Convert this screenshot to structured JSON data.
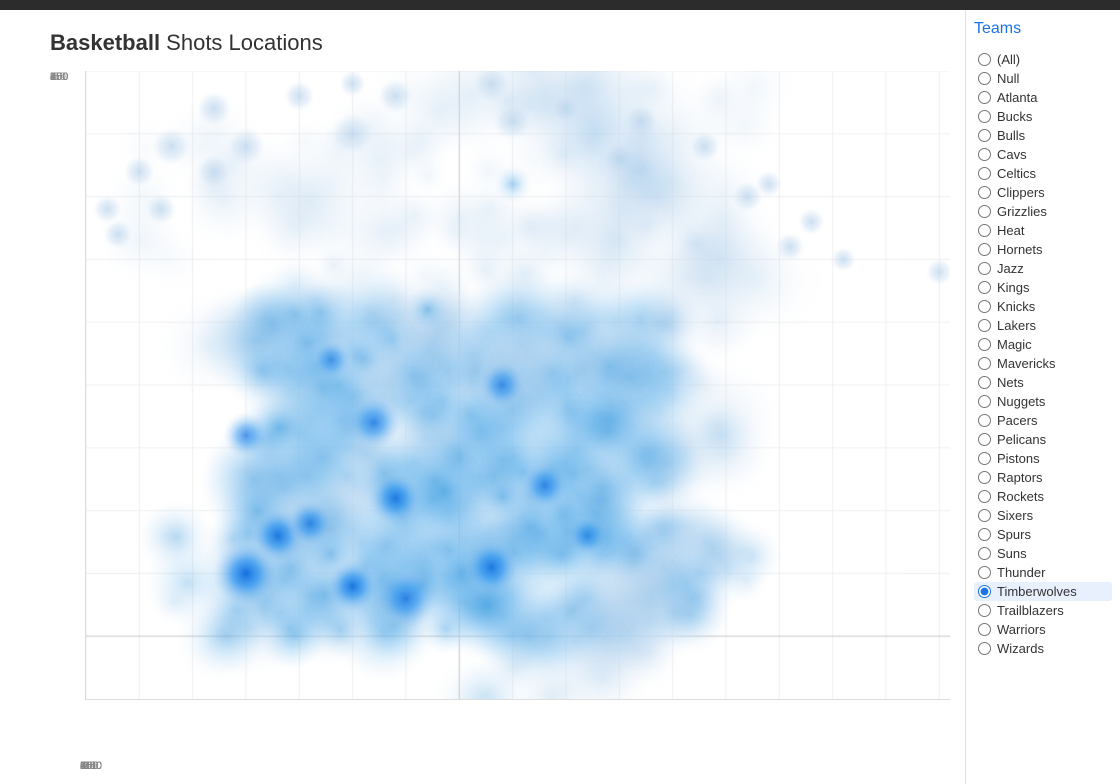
{
  "title": {
    "prefix": "Basketball",
    "suffix": " Shots Locations"
  },
  "chart": {
    "yAxis": {
      "labels": [
        "450",
        "400",
        "350",
        "300",
        "250",
        "200",
        "150",
        "100",
        "50",
        "0",
        "-50"
      ]
    },
    "xAxis": {
      "labels": [
        "-350",
        "-300",
        "-250",
        "-200",
        "-150",
        "-100",
        "-50",
        "0",
        "50",
        "100",
        "150",
        "200",
        "250",
        "300",
        "350",
        "400",
        "450"
      ]
    }
  },
  "sidebar": {
    "title": "Teams",
    "teams": [
      {
        "label": "(All)",
        "selected": false
      },
      {
        "label": "Null",
        "selected": false
      },
      {
        "label": "Atlanta",
        "selected": false
      },
      {
        "label": "Bucks",
        "selected": false
      },
      {
        "label": "Bulls",
        "selected": false
      },
      {
        "label": "Cavs",
        "selected": false
      },
      {
        "label": "Celtics",
        "selected": false
      },
      {
        "label": "Clippers",
        "selected": false
      },
      {
        "label": "Grizzlies",
        "selected": false
      },
      {
        "label": "Heat",
        "selected": false
      },
      {
        "label": "Hornets",
        "selected": false
      },
      {
        "label": "Jazz",
        "selected": false
      },
      {
        "label": "Kings",
        "selected": false
      },
      {
        "label": "Knicks",
        "selected": false
      },
      {
        "label": "Lakers",
        "selected": false
      },
      {
        "label": "Magic",
        "selected": false
      },
      {
        "label": "Mavericks",
        "selected": false
      },
      {
        "label": "Nets",
        "selected": false
      },
      {
        "label": "Nuggets",
        "selected": false
      },
      {
        "label": "Pacers",
        "selected": false
      },
      {
        "label": "Pelicans",
        "selected": false
      },
      {
        "label": "Pistons",
        "selected": false
      },
      {
        "label": "Raptors",
        "selected": false
      },
      {
        "label": "Rockets",
        "selected": false
      },
      {
        "label": "Sixers",
        "selected": false
      },
      {
        "label": "Spurs",
        "selected": false
      },
      {
        "label": "Suns",
        "selected": false
      },
      {
        "label": "Thunder",
        "selected": false
      },
      {
        "label": "Timberwolves",
        "selected": true
      },
      {
        "label": "Trailblazers",
        "selected": false
      },
      {
        "label": "Warriors",
        "selected": false
      },
      {
        "label": "Wizards",
        "selected": false
      }
    ]
  }
}
